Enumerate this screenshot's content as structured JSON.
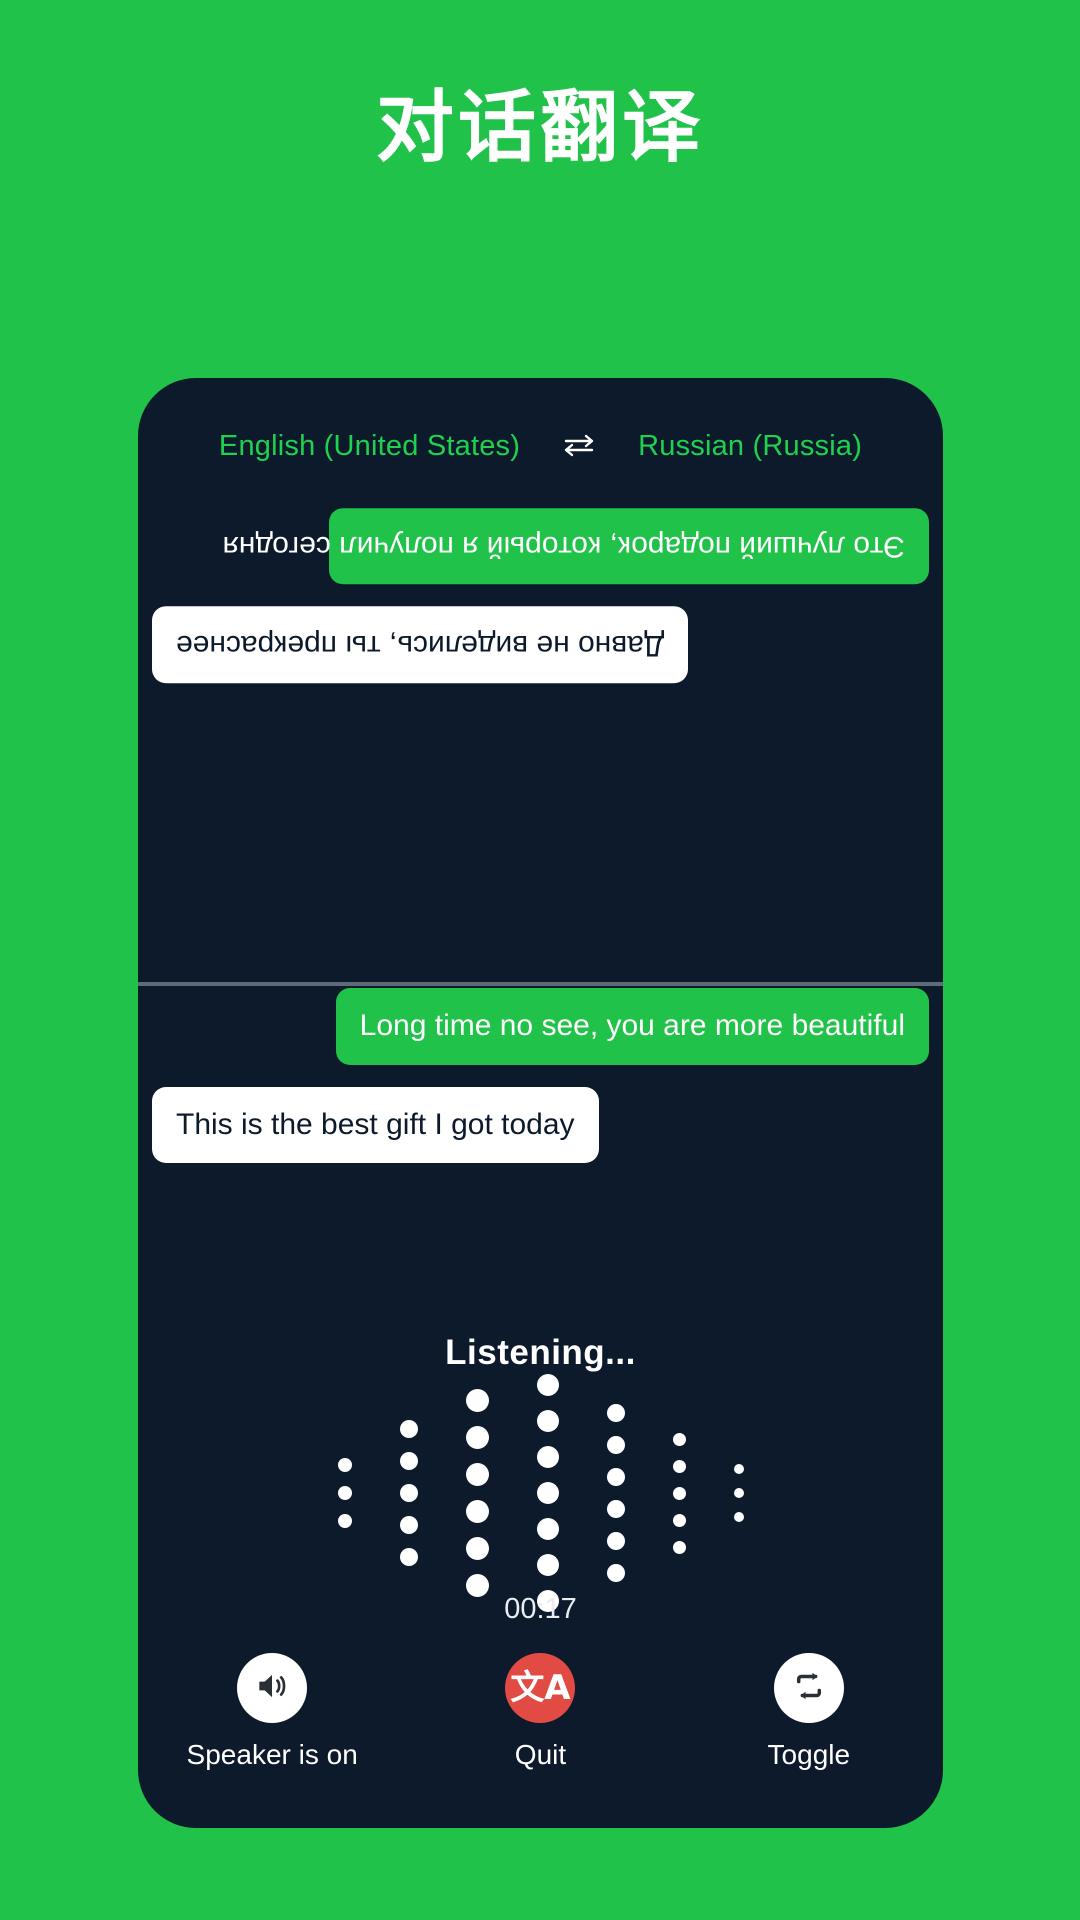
{
  "theme": {
    "background": "#21c24a",
    "card_background": "#0c1a2b",
    "accent_green": "#1fd14f",
    "bubble_green": "#21c24a",
    "bubble_white": "#ffffff",
    "danger_red": "#e24b43",
    "divider": "#5d6a78"
  },
  "page_title": "对话翻译",
  "languages": {
    "source": "English (United States)",
    "target": "Russian (Russia)",
    "swap_icon": "swap-horizontal-icon"
  },
  "conversation": {
    "remote_pane": {
      "rotated": true,
      "messages": [
        {
          "side": "left",
          "style": "green",
          "text": "Это лучший подарок, который я получил сегодня"
        },
        {
          "side": "right",
          "style": "white",
          "text": "Давно не виделись, ты прекраснее"
        }
      ]
    },
    "local_pane": {
      "rotated": false,
      "messages": [
        {
          "side": "right",
          "style": "green",
          "text": "Long time no see, you are more beautiful"
        },
        {
          "side": "left",
          "style": "white",
          "text": "This is the best gift I got today"
        }
      ]
    }
  },
  "status": {
    "listening_label": "Listening...",
    "timer": "00:17"
  },
  "waveform": {
    "columns": [
      {
        "count": 3,
        "size": 14
      },
      {
        "count": 5,
        "size": 18
      },
      {
        "count": 6,
        "size": 23
      },
      {
        "count": 7,
        "size": 22
      },
      {
        "count": 6,
        "size": 18
      },
      {
        "count": 5,
        "size": 13
      },
      {
        "count": 3,
        "size": 10
      }
    ],
    "gap": 14
  },
  "controls": [
    {
      "name": "speaker",
      "label": "Speaker is on",
      "icon": "speaker-on-icon",
      "circle": "light"
    },
    {
      "name": "quit",
      "label": "Quit",
      "icon": "translate-icon",
      "circle": "danger"
    },
    {
      "name": "toggle",
      "label": "Toggle",
      "icon": "repeat-swap-icon",
      "circle": "light"
    }
  ]
}
